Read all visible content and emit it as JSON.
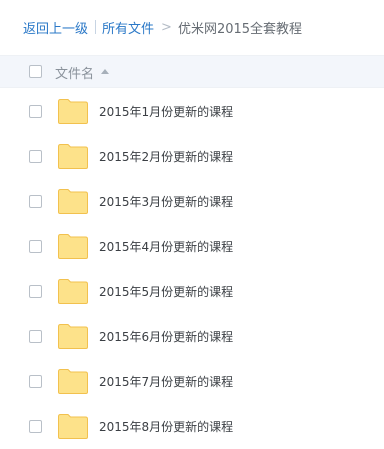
{
  "breadcrumb": {
    "back_label": "返回上一级",
    "all_files_label": "所有文件",
    "separator_arrow": ">",
    "current_label": "优米网2015全套教程"
  },
  "list_header": {
    "name_label": "文件名"
  },
  "files": [
    {
      "name": "2015年1月份更新的课程"
    },
    {
      "name": "2015年2月份更新的课程"
    },
    {
      "name": "2015年3月份更新的课程"
    },
    {
      "name": "2015年4月份更新的课程"
    },
    {
      "name": "2015年5月份更新的课程"
    },
    {
      "name": "2015年6月份更新的课程"
    },
    {
      "name": "2015年7月份更新的课程"
    },
    {
      "name": "2015年8月份更新的课程"
    }
  ],
  "colors": {
    "link": "#2a78c7",
    "folder_fill": "#fde28a",
    "folder_stroke": "#f2c14e",
    "header_bg": "#f3f6fb"
  },
  "icons": {
    "folder": "folder-icon",
    "sort": "sort-ascending-icon",
    "checkbox": "checkbox-icon"
  }
}
